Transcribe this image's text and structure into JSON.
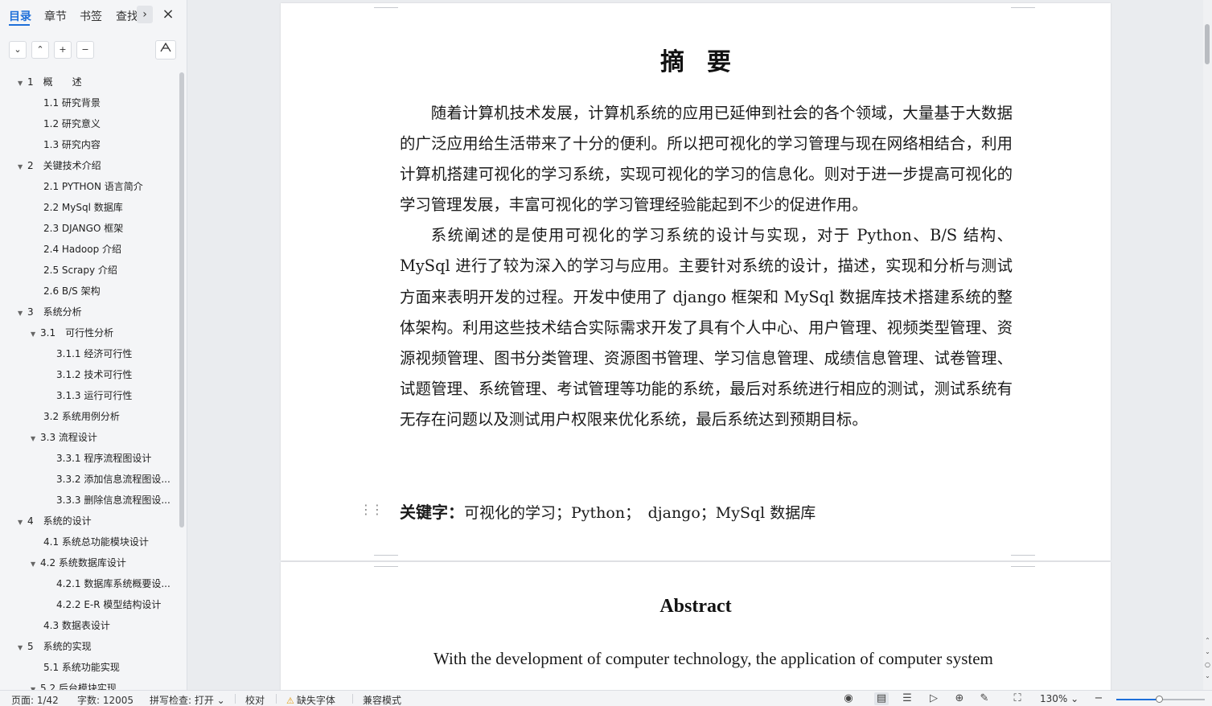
{
  "sidebar": {
    "tabs": [
      {
        "label": "目录",
        "active": true
      },
      {
        "label": "章节",
        "active": false
      },
      {
        "label": "书签",
        "active": false
      },
      {
        "label": "查找",
        "active": false
      }
    ],
    "more_icon": "chevron-right-icon",
    "close_icon": "close-icon",
    "tools": {
      "collapse": "chevron-down-icon",
      "expand": "chevron-up-icon",
      "add": "plus-icon",
      "remove": "minus-icon",
      "smart": "smart-toc-icon"
    },
    "toc": [
      {
        "label": "1　概　　述",
        "level": 1,
        "arrow": true
      },
      {
        "label": "1.1 研究背景",
        "level": 2,
        "arrow": false
      },
      {
        "label": "1.2 研究意义",
        "level": 2,
        "arrow": false
      },
      {
        "label": "1.3 研究内容",
        "level": 2,
        "arrow": false
      },
      {
        "label": "2　关键技术介绍",
        "level": 1,
        "arrow": true
      },
      {
        "label": "2.1 PYTHON 语言简介",
        "level": 2,
        "arrow": false
      },
      {
        "label": "2.2 MySql 数据库",
        "level": 2,
        "arrow": false
      },
      {
        "label": "2.3 DJANGO 框架",
        "level": 2,
        "arrow": false
      },
      {
        "label": "2.4 Hadoop 介绍",
        "level": 2,
        "arrow": false
      },
      {
        "label": "2.5 Scrapy 介绍",
        "level": 2,
        "arrow": false
      },
      {
        "label": "2.6 B/S 架构",
        "level": 2,
        "arrow": false
      },
      {
        "label": "3　系统分析",
        "level": 1,
        "arrow": true
      },
      {
        "label": "3.1　可行性分析",
        "level": 2,
        "arrow": true
      },
      {
        "label": "3.1.1 经济可行性",
        "level": 3,
        "arrow": false
      },
      {
        "label": "3.1.2 技术可行性",
        "level": 3,
        "arrow": false
      },
      {
        "label": "3.1.3 运行可行性",
        "level": 3,
        "arrow": false
      },
      {
        "label": "3.2 系统用例分析",
        "level": 2,
        "arrow": false
      },
      {
        "label": "3.3 流程设计",
        "level": 2,
        "arrow": true
      },
      {
        "label": "3.3.1 程序流程图设计",
        "level": 3,
        "arrow": false
      },
      {
        "label": "3.3.2 添加信息流程图设...",
        "level": 3,
        "arrow": false
      },
      {
        "label": "3.3.3 删除信息流程图设...",
        "level": 3,
        "arrow": false
      },
      {
        "label": "4　系统的设计",
        "level": 1,
        "arrow": true
      },
      {
        "label": "4.1 系统总功能模块设计",
        "level": 2,
        "arrow": false
      },
      {
        "label": "4.2 系统数据库设计",
        "level": 2,
        "arrow": true
      },
      {
        "label": "4.2.1 数据库系统概要设...",
        "level": 3,
        "arrow": false
      },
      {
        "label": "4.2.2 E-R 模型结构设计",
        "level": 3,
        "arrow": false
      },
      {
        "label": "4.3 数据表设计",
        "level": 2,
        "arrow": false
      },
      {
        "label": "5　系统的实现",
        "level": 1,
        "arrow": true
      },
      {
        "label": "5.1 系统功能实现",
        "level": 2,
        "arrow": false
      },
      {
        "label": "5.2 后台模块实现",
        "level": 2,
        "arrow": true
      }
    ]
  },
  "document": {
    "cn_title": "摘要",
    "cn_paragraphs": [
      "随着计算机技术发展，计算机系统的应用已延伸到社会的各个领域，大量基于大数据的广泛应用给生活带来了十分的便利。所以把可视化的学习管理与现在网络相结合，利用计算机搭建可视化的学习系统，实现可视化的学习的信息化。则对于进一步提高可视化的学习管理发展，丰富可视化的学习管理经验能起到不少的促进作用。",
      "系统阐述的是使用可视化的学习系统的设计与实现，对于 Python、B/S 结构、MySql 进行了较为深入的学习与应用。主要针对系统的设计，描述，实现和分析与测试方面来表明开发的过程。开发中使用了 django 框架和 MySql 数据库技术搭建系统的整体架构。利用这些技术结合实际需求开发了具有个人中心、用户管理、视频类型管理、资源视频管理、图书分类管理、资源图书管理、学习信息管理、成绩信息管理、试卷管理、试题管理、系统管理、考试管理等功能的系统，最后对系统进行相应的测试，测试系统有无存在问题以及测试用户权限来优化系统，最后系统达到预期目标。"
    ],
    "keyword_label": "关键字：",
    "keyword_text": "可视化的学习；Python；　django；MySql 数据库",
    "en_title": "Abstract",
    "en_first_line": "With the development of computer technology, the application of computer system"
  },
  "statusbar": {
    "page": "页面: 1/42",
    "words": "字数: 12005",
    "spellcheck": "拼写检查: 打开 ⌄",
    "proofread": "校对",
    "missing_font": "缺失字体",
    "compat": "兼容模式",
    "zoom": "130% ⌄",
    "zoom_level_pct": 48
  },
  "colors": {
    "accent": "#1e6fd9",
    "warning": "#e39b12"
  }
}
